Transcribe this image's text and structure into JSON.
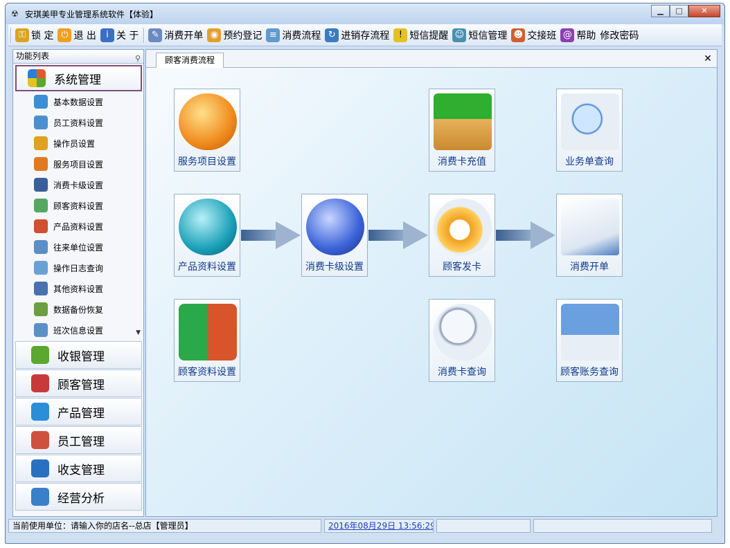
{
  "window": {
    "title": "安琪美甲专业管理系统软件【体验】",
    "controls": {
      "minimize": "▁",
      "maximize": "□",
      "close": "✕"
    }
  },
  "toolbar": {
    "items": [
      {
        "label": "锁 定",
        "icon": "key-icon",
        "color": "#d9a520"
      },
      {
        "label": "退 出",
        "icon": "power-icon",
        "color": "#f0a020"
      },
      {
        "label": "关 于",
        "icon": "info-icon",
        "color": "#3b6fc4"
      },
      {
        "label": "消费开单",
        "icon": "pen-icon",
        "color": "#6b8bc0"
      },
      {
        "label": "预约登记",
        "icon": "globe-icon",
        "color": "#e0a030"
      },
      {
        "label": "消费流程",
        "icon": "flow-icon",
        "color": "#5f9ad0"
      },
      {
        "label": "进销存流程",
        "icon": "cycle-icon",
        "color": "#3a7cc0"
      },
      {
        "label": "短信提醒",
        "icon": "warning-icon",
        "color": "#e6c020"
      },
      {
        "label": "短信管理",
        "icon": "users-icon",
        "color": "#4a8fb0"
      },
      {
        "label": "交接班",
        "icon": "group-icon",
        "color": "#d06030"
      },
      {
        "label": "帮助",
        "icon": "help-icon",
        "color": "#8c3fb0"
      },
      {
        "label": "修改密码",
        "icon": "",
        "color": ""
      }
    ]
  },
  "sidebar": {
    "header": "功能列表",
    "active_group": {
      "label": "系统管理",
      "color": "#e25a2b"
    },
    "sub_items": [
      {
        "label": "基本数据设置",
        "icon": "settings-icon",
        "color": "#3b8fd4"
      },
      {
        "label": "员工资料设置",
        "icon": "edit-icon",
        "color": "#4a90d0"
      },
      {
        "label": "操作员设置",
        "icon": "tools-icon",
        "color": "#e0a020"
      },
      {
        "label": "服务项目设置",
        "icon": "service-icon",
        "color": "#e07a20"
      },
      {
        "label": "消费卡级设置",
        "icon": "card-icon",
        "color": "#3a5f9a"
      },
      {
        "label": "顾客资料设置",
        "icon": "customers-icon",
        "color": "#55a860"
      },
      {
        "label": "产品资料设置",
        "icon": "product-icon",
        "color": "#d05030"
      },
      {
        "label": "往来单位设置",
        "icon": "contact-icon",
        "color": "#5a8fc8"
      },
      {
        "label": "操作日志查询",
        "icon": "log-icon",
        "color": "#6aa0d8"
      },
      {
        "label": "其他资料设置",
        "icon": "other-icon",
        "color": "#4a70b0"
      },
      {
        "label": "数据备份恢复",
        "icon": "backup-icon",
        "color": "#6aa040"
      },
      {
        "label": "班次信息设置",
        "icon": "shift-icon",
        "color": "#5a90c8"
      }
    ],
    "groups": [
      {
        "label": "收银管理",
        "icon": "cashier-icon",
        "color": "#5aa830"
      },
      {
        "label": "顾客管理",
        "icon": "customer-icon",
        "color": "#c83a3a"
      },
      {
        "label": "产品管理",
        "icon": "cubes-icon",
        "color": "#2a8fd8"
      },
      {
        "label": "员工管理",
        "icon": "staff-icon",
        "color": "#d05040"
      },
      {
        "label": "收支管理",
        "icon": "finance-icon",
        "color": "#2a70c0"
      },
      {
        "label": "经营分析",
        "icon": "analysis-icon",
        "color": "#3a80c8"
      }
    ]
  },
  "tabs": [
    {
      "label": "顾客消费流程"
    }
  ],
  "flow": {
    "tiles": [
      {
        "label": "服务项目设置",
        "icon": "service-setup-icon",
        "color": "#f08a1c"
      },
      {
        "label": "消费卡充值",
        "icon": "card-recharge-icon",
        "color": "#2fae2f"
      },
      {
        "label": "业务单查询",
        "icon": "order-search-icon",
        "color": "#3a7fd0"
      },
      {
        "label": "产品资料设置",
        "icon": "product-setup-icon",
        "color": "#1aa0b8"
      },
      {
        "label": "消费卡级设置",
        "icon": "card-level-icon",
        "color": "#3a62d8"
      },
      {
        "label": "顾客发卡",
        "icon": "issue-card-icon",
        "color": "#f0a020"
      },
      {
        "label": "消费开单",
        "icon": "consume-order-icon",
        "color": "#4a7cc0"
      },
      {
        "label": "顾客资料设置",
        "icon": "customer-setup-icon",
        "color": "#d8542a"
      },
      {
        "label": "消费卡查询",
        "icon": "card-search-icon",
        "color": "#2a8ad0"
      },
      {
        "label": "顾客账务查询",
        "icon": "account-search-icon",
        "color": "#6aa0e0"
      }
    ]
  },
  "status": {
    "unit": "当前使用单位：请输入你的店名--总店【管理员】",
    "datetime": "2016年08月29日  13:56:29",
    "cell3": "",
    "cell4": ""
  }
}
